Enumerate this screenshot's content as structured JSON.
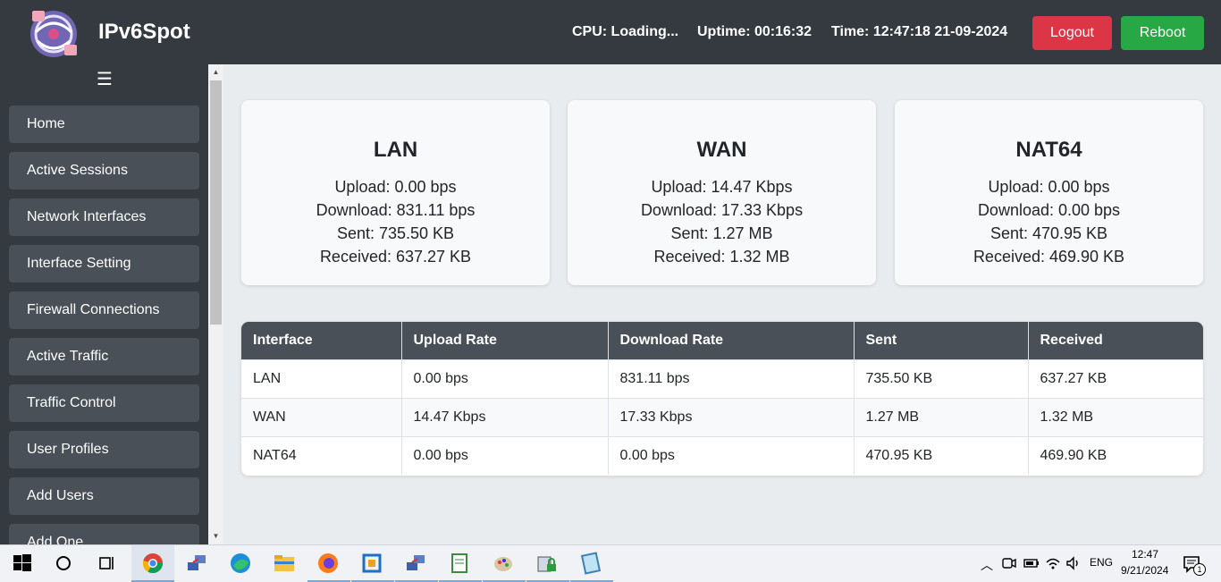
{
  "header": {
    "brand": "IPv6Spot",
    "cpu": "CPU: Loading...",
    "uptime": "Uptime: 00:16:32",
    "time": "Time: 12:47:18 21-09-2024",
    "logout_label": "Logout",
    "reboot_label": "Reboot"
  },
  "sidebar": {
    "menu_icon": "☰",
    "items": [
      {
        "label": "Home"
      },
      {
        "label": "Active Sessions"
      },
      {
        "label": "Network Interfaces"
      },
      {
        "label": "Interface Setting"
      },
      {
        "label": "Firewall Connections"
      },
      {
        "label": "Active Traffic"
      },
      {
        "label": "Traffic Control"
      },
      {
        "label": "User Profiles"
      },
      {
        "label": "Add Users"
      },
      {
        "label": "Add One"
      }
    ]
  },
  "cards": [
    {
      "title": "LAN",
      "upload": "Upload: 0.00 bps",
      "download": "Download: 831.11 bps",
      "sent": "Sent: 735.50 KB",
      "received": "Received: 637.27 KB"
    },
    {
      "title": "WAN",
      "upload": "Upload: 14.47 Kbps",
      "download": "Download: 17.33 Kbps",
      "sent": "Sent: 1.27 MB",
      "received": "Received: 1.32 MB"
    },
    {
      "title": "NAT64",
      "upload": "Upload: 0.00 bps",
      "download": "Download: 0.00 bps",
      "sent": "Sent: 470.95 KB",
      "received": "Received: 469.90 KB"
    }
  ],
  "table": {
    "headers": [
      "Interface",
      "Upload Rate",
      "Download Rate",
      "Sent",
      "Received"
    ],
    "rows": [
      [
        "LAN",
        "0.00 bps",
        "831.11 bps",
        "735.50 KB",
        "637.27 KB"
      ],
      [
        "WAN",
        "14.47 Kbps",
        "17.33 Kbps",
        "1.27 MB",
        "1.32 MB"
      ],
      [
        "NAT64",
        "0.00 bps",
        "0.00 bps",
        "470.95 KB",
        "469.90 KB"
      ]
    ]
  },
  "taskbar": {
    "apps": [
      "windows-start-icon",
      "search-icon",
      "task-view-icon",
      "chrome-icon",
      "network-app-icon",
      "edge-icon",
      "file-explorer-icon",
      "firefox-icon",
      "virtualbox-icon",
      "network-app-icon",
      "notepad-icon",
      "paint-icon",
      "lock-app-icon",
      "notepad-icon"
    ],
    "tray_lang": "ENG",
    "tray_time": "12:47",
    "tray_date": "9/21/2024",
    "notification_count": "1"
  },
  "colors": {
    "header_bg": "#343a40",
    "nav_item_bg": "#495057",
    "logout": "#dc3545",
    "reboot": "#28a745",
    "content_bg": "#e9ecef"
  }
}
